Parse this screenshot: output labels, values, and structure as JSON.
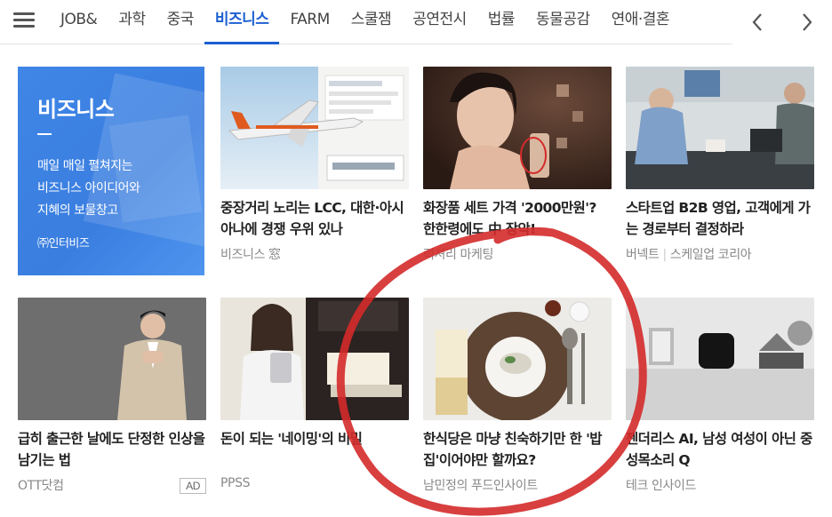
{
  "tabs": {
    "items": [
      "JOB&",
      "과학",
      "중국",
      "비즈니스",
      "FARM",
      "스쿨잼",
      "공연전시",
      "법률",
      "동물공감",
      "연애·결혼"
    ],
    "active_index": 3
  },
  "nav": {
    "prev_icon": "chevron-left-icon",
    "next_icon": "chevron-right-icon",
    "menu_icon": "hamburger-menu-icon"
  },
  "promo": {
    "title": "비즈니스",
    "description": "매일 매일 펼쳐지는\n비즈니스 아이디어와\n지혜의 보물창고",
    "brand": "㈜인터비즈",
    "color": "#3f86e6"
  },
  "cards": [
    {
      "title": "중장거리 노리는 LCC, 대한·아시아나에 경쟁 우위 있나",
      "source": "비즈니스 窓",
      "source2": ""
    },
    {
      "title": "화장품 세트 가격 '2000만원'? 한한령에도 中 장악!",
      "source": "럭셔리 마케팅",
      "source2": ""
    },
    {
      "title": "스타트업 B2B 영업, 고객에게 가는 경로부터 결정하라",
      "source": "버넥트",
      "source2": "스케일업 코리아"
    },
    {
      "title": "급히 출근한 날에도 단정한 인상을 남기는 법",
      "source": "OTT닷컴",
      "source2": "",
      "ad": "AD"
    },
    {
      "title": "돈이 되는 '네이밍'의 비밀",
      "source": "PPSS",
      "source2": ""
    },
    {
      "title": "한식당은 마냥 친숙하기만 한 '밥집'이어야만 할까요?",
      "source": "남민정의 푸드인사이트",
      "source2": ""
    },
    {
      "title": "젠더리스 AI, 남성 여성이 아닌 중성목소리 Q",
      "source": "테크 인사이드",
      "source2": ""
    }
  ],
  "colors": {
    "accent": "#1b5fd1",
    "annotation": "#d42a2a"
  }
}
